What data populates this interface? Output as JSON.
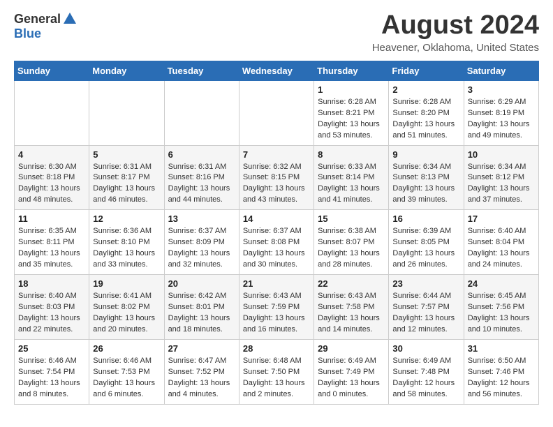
{
  "header": {
    "logo_general": "General",
    "logo_blue": "Blue",
    "month_title": "August 2024",
    "location": "Heavener, Oklahoma, United States"
  },
  "days_of_week": [
    "Sunday",
    "Monday",
    "Tuesday",
    "Wednesday",
    "Thursday",
    "Friday",
    "Saturday"
  ],
  "weeks": [
    [
      {
        "day": "",
        "info": ""
      },
      {
        "day": "",
        "info": ""
      },
      {
        "day": "",
        "info": ""
      },
      {
        "day": "",
        "info": ""
      },
      {
        "day": "1",
        "info": "Sunrise: 6:28 AM\nSunset: 8:21 PM\nDaylight: 13 hours\nand 53 minutes."
      },
      {
        "day": "2",
        "info": "Sunrise: 6:28 AM\nSunset: 8:20 PM\nDaylight: 13 hours\nand 51 minutes."
      },
      {
        "day": "3",
        "info": "Sunrise: 6:29 AM\nSunset: 8:19 PM\nDaylight: 13 hours\nand 49 minutes."
      }
    ],
    [
      {
        "day": "4",
        "info": "Sunrise: 6:30 AM\nSunset: 8:18 PM\nDaylight: 13 hours\nand 48 minutes."
      },
      {
        "day": "5",
        "info": "Sunrise: 6:31 AM\nSunset: 8:17 PM\nDaylight: 13 hours\nand 46 minutes."
      },
      {
        "day": "6",
        "info": "Sunrise: 6:31 AM\nSunset: 8:16 PM\nDaylight: 13 hours\nand 44 minutes."
      },
      {
        "day": "7",
        "info": "Sunrise: 6:32 AM\nSunset: 8:15 PM\nDaylight: 13 hours\nand 43 minutes."
      },
      {
        "day": "8",
        "info": "Sunrise: 6:33 AM\nSunset: 8:14 PM\nDaylight: 13 hours\nand 41 minutes."
      },
      {
        "day": "9",
        "info": "Sunrise: 6:34 AM\nSunset: 8:13 PM\nDaylight: 13 hours\nand 39 minutes."
      },
      {
        "day": "10",
        "info": "Sunrise: 6:34 AM\nSunset: 8:12 PM\nDaylight: 13 hours\nand 37 minutes."
      }
    ],
    [
      {
        "day": "11",
        "info": "Sunrise: 6:35 AM\nSunset: 8:11 PM\nDaylight: 13 hours\nand 35 minutes."
      },
      {
        "day": "12",
        "info": "Sunrise: 6:36 AM\nSunset: 8:10 PM\nDaylight: 13 hours\nand 33 minutes."
      },
      {
        "day": "13",
        "info": "Sunrise: 6:37 AM\nSunset: 8:09 PM\nDaylight: 13 hours\nand 32 minutes."
      },
      {
        "day": "14",
        "info": "Sunrise: 6:37 AM\nSunset: 8:08 PM\nDaylight: 13 hours\nand 30 minutes."
      },
      {
        "day": "15",
        "info": "Sunrise: 6:38 AM\nSunset: 8:07 PM\nDaylight: 13 hours\nand 28 minutes."
      },
      {
        "day": "16",
        "info": "Sunrise: 6:39 AM\nSunset: 8:05 PM\nDaylight: 13 hours\nand 26 minutes."
      },
      {
        "day": "17",
        "info": "Sunrise: 6:40 AM\nSunset: 8:04 PM\nDaylight: 13 hours\nand 24 minutes."
      }
    ],
    [
      {
        "day": "18",
        "info": "Sunrise: 6:40 AM\nSunset: 8:03 PM\nDaylight: 13 hours\nand 22 minutes."
      },
      {
        "day": "19",
        "info": "Sunrise: 6:41 AM\nSunset: 8:02 PM\nDaylight: 13 hours\nand 20 minutes."
      },
      {
        "day": "20",
        "info": "Sunrise: 6:42 AM\nSunset: 8:01 PM\nDaylight: 13 hours\nand 18 minutes."
      },
      {
        "day": "21",
        "info": "Sunrise: 6:43 AM\nSunset: 7:59 PM\nDaylight: 13 hours\nand 16 minutes."
      },
      {
        "day": "22",
        "info": "Sunrise: 6:43 AM\nSunset: 7:58 PM\nDaylight: 13 hours\nand 14 minutes."
      },
      {
        "day": "23",
        "info": "Sunrise: 6:44 AM\nSunset: 7:57 PM\nDaylight: 13 hours\nand 12 minutes."
      },
      {
        "day": "24",
        "info": "Sunrise: 6:45 AM\nSunset: 7:56 PM\nDaylight: 13 hours\nand 10 minutes."
      }
    ],
    [
      {
        "day": "25",
        "info": "Sunrise: 6:46 AM\nSunset: 7:54 PM\nDaylight: 13 hours\nand 8 minutes."
      },
      {
        "day": "26",
        "info": "Sunrise: 6:46 AM\nSunset: 7:53 PM\nDaylight: 13 hours\nand 6 minutes."
      },
      {
        "day": "27",
        "info": "Sunrise: 6:47 AM\nSunset: 7:52 PM\nDaylight: 13 hours\nand 4 minutes."
      },
      {
        "day": "28",
        "info": "Sunrise: 6:48 AM\nSunset: 7:50 PM\nDaylight: 13 hours\nand 2 minutes."
      },
      {
        "day": "29",
        "info": "Sunrise: 6:49 AM\nSunset: 7:49 PM\nDaylight: 13 hours\nand 0 minutes."
      },
      {
        "day": "30",
        "info": "Sunrise: 6:49 AM\nSunset: 7:48 PM\nDaylight: 12 hours\nand 58 minutes."
      },
      {
        "day": "31",
        "info": "Sunrise: 6:50 AM\nSunset: 7:46 PM\nDaylight: 12 hours\nand 56 minutes."
      }
    ]
  ]
}
